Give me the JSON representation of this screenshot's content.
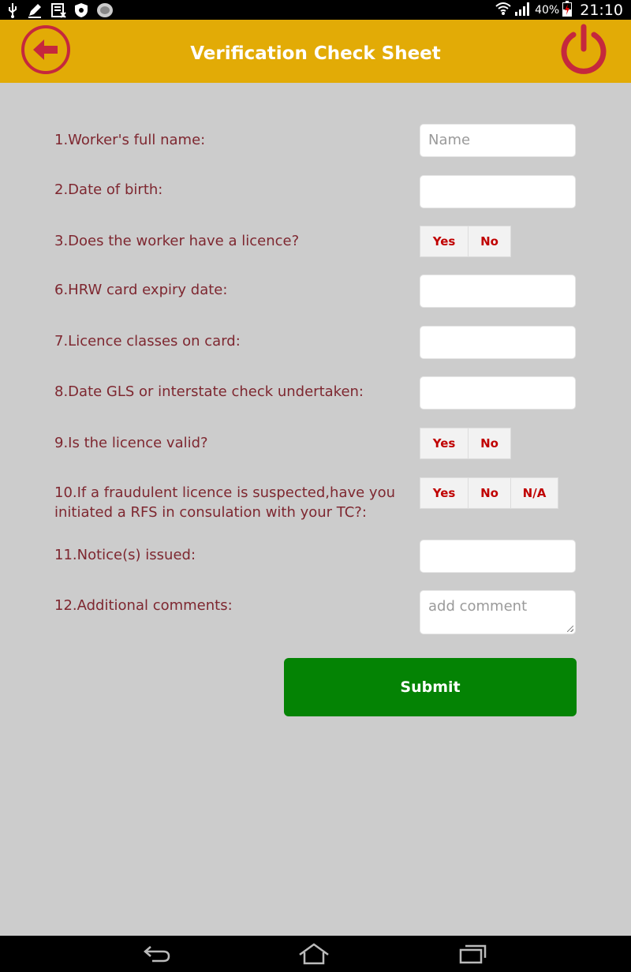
{
  "status_bar": {
    "icons_left": [
      "usb-icon",
      "edit-icon",
      "sd-card-icon",
      "shield-icon",
      "app-icon"
    ],
    "battery_percent": "40%",
    "time": "21:10"
  },
  "header": {
    "title": "Verification Check Sheet",
    "accent_color": "#e2ab06",
    "icon_color": "#c5283d"
  },
  "form": {
    "q1": {
      "label": "1.Worker's full name:",
      "placeholder": "Name"
    },
    "q2": {
      "label": "2.Date of birth:"
    },
    "q3": {
      "label": "3.Does the worker have a licence?",
      "options": [
        "Yes",
        "No"
      ]
    },
    "q6": {
      "label": "6.HRW card expiry date:"
    },
    "q7": {
      "label": "7.Licence classes on card:"
    },
    "q8": {
      "label": "8.Date GLS or interstate check undertaken:"
    },
    "q9": {
      "label": "9.Is the licence valid?",
      "options": [
        "Yes",
        "No"
      ]
    },
    "q10": {
      "label_line1": "10.If a fraudulent licence is suspected,have you",
      "label_line2": "initiated a RFS in consulation with your TC?:",
      "options": [
        "Yes",
        "No",
        "N/A"
      ]
    },
    "q11": {
      "label": "11.Notice(s) issued:"
    },
    "q12": {
      "label": "12.Additional comments:",
      "placeholder": "add comment"
    },
    "submit_label": "Submit",
    "label_color": "#7e2730",
    "option_color": "#c00000",
    "submit_color": "#048304"
  },
  "nav_bar": {
    "buttons": [
      "back-nav-icon",
      "home-nav-icon",
      "recents-nav-icon"
    ]
  }
}
